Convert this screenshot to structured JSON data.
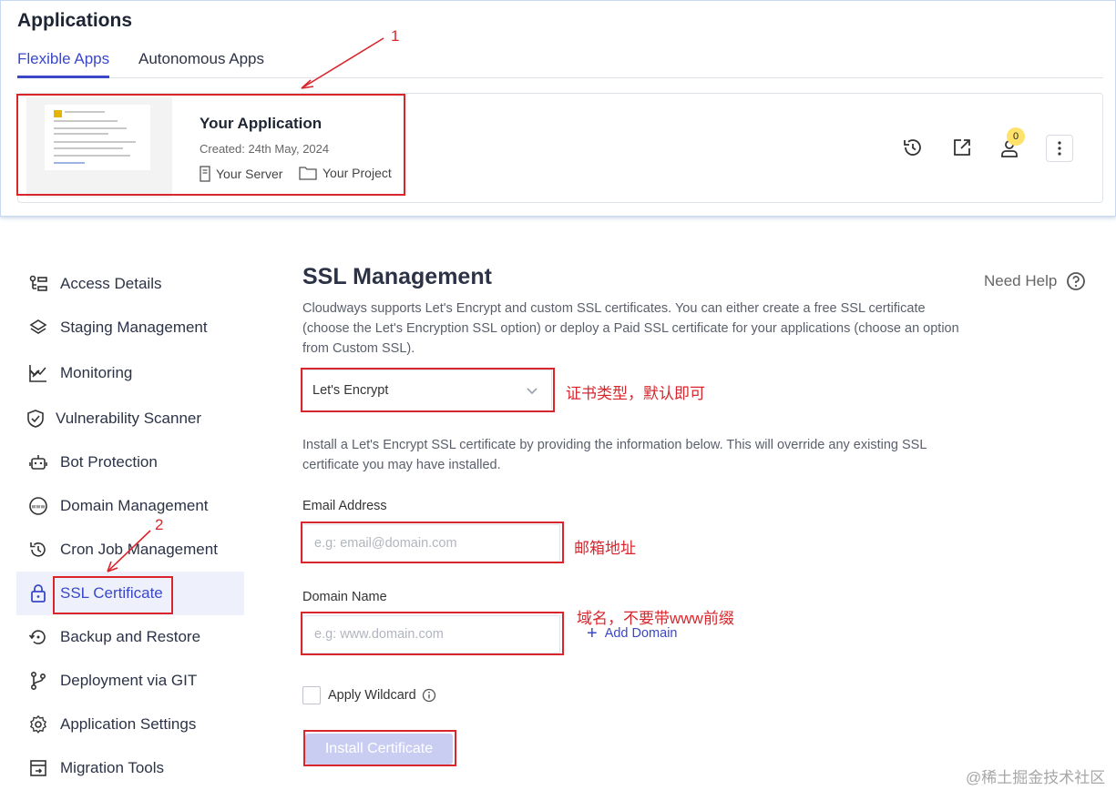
{
  "header": {
    "title": "Applications",
    "tabs": [
      {
        "label": "Flexible Apps",
        "active": true
      },
      {
        "label": "Autonomous Apps",
        "active": false
      }
    ]
  },
  "app_card": {
    "name": "Your Application",
    "created": "Created: 24th May, 2024",
    "server": "Your Server",
    "project": "Your Project",
    "notification_count": "0"
  },
  "annotations": {
    "marker_1": "1",
    "marker_2": "2",
    "note_cert_type": "证书类型，默认即可",
    "note_email": "邮箱地址",
    "note_domain": "域名，不要带www前缀",
    "color": "#d9262c"
  },
  "sidebar": {
    "items": [
      {
        "label": "Access Details",
        "icon": "access-details-icon"
      },
      {
        "label": "Staging Management",
        "icon": "layers-icon"
      },
      {
        "label": "Monitoring",
        "icon": "chart-line-icon"
      },
      {
        "label": "Vulnerability Scanner",
        "icon": "shield-scan-icon"
      },
      {
        "label": "Bot Protection",
        "icon": "robot-icon"
      },
      {
        "label": "Domain Management",
        "icon": "www-icon"
      },
      {
        "label": "Cron Job Management",
        "icon": "history-icon"
      },
      {
        "label": "SSL Certificate",
        "icon": "lock-icon",
        "active": true
      },
      {
        "label": "Backup and Restore",
        "icon": "backup-icon"
      },
      {
        "label": "Deployment via GIT",
        "icon": "git-branch-icon"
      },
      {
        "label": "Application Settings",
        "icon": "gear-icon"
      },
      {
        "label": "Migration Tools",
        "icon": "migration-icon"
      }
    ]
  },
  "ssl": {
    "title": "SSL Management",
    "need_help": "Need Help",
    "description": "Cloudways supports Let's Encrypt and custom SSL certificates. You can either create a free SSL certificate (choose the Let's Encryption SSL option) or deploy a Paid SSL certificate for your applications (choose an option from Custom SSL).",
    "cert_type_selected": "Let's Encrypt",
    "install_description": "Install a Let's Encrypt SSL certificate by providing the information below. This will override any existing SSL certificate you may have installed.",
    "email_label": "Email Address",
    "email_placeholder": "e.g: email@domain.com",
    "domain_label": "Domain Name",
    "domain_placeholder": "e.g: www.domain.com",
    "add_domain": "Add Domain",
    "apply_wildcard": "Apply Wildcard",
    "install_button": "Install Certificate"
  },
  "watermark": "@稀土掘金技术社区",
  "colors": {
    "accent": "#3a48c8",
    "button_disabled": "#c9cdf1"
  }
}
